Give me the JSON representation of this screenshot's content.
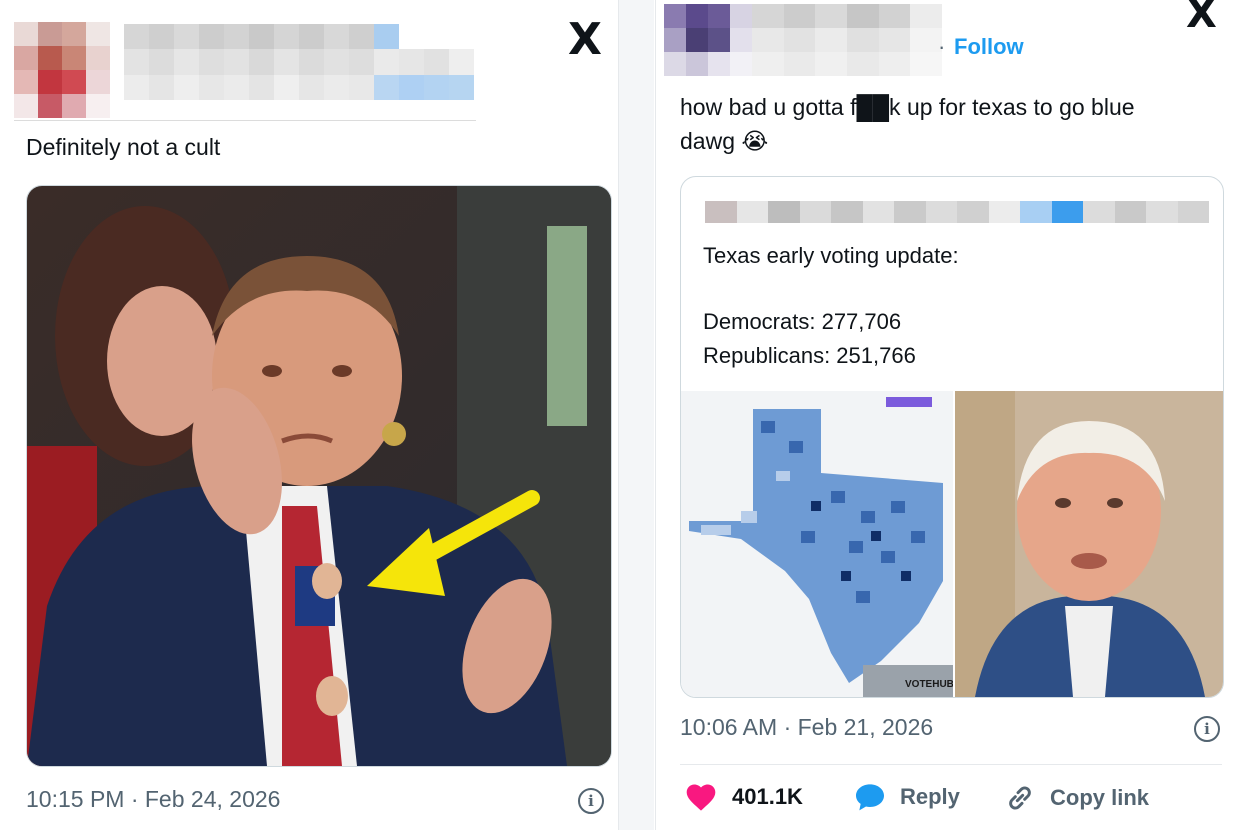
{
  "left_tweet": {
    "text": "Definitely not a cult",
    "timestamp": "10:15 PM · Feb 24, 2026",
    "logo": "X"
  },
  "right_tweet": {
    "follow_label": "Follow",
    "text_line1": "how bad u gotta f██k up for texas to go blue",
    "text_line2": "dawg 😭",
    "timestamp": "10:06 AM · Feb 21, 2026",
    "logo": "X",
    "quote": {
      "line1": "Texas early voting update:",
      "line2": "Democrats: 277,706",
      "line3": "Republicans: 251,766"
    },
    "actions": {
      "likes": "401.1K",
      "reply": "Reply",
      "copy_link": "Copy link"
    },
    "map_watermark": "VOTEHUB"
  },
  "colors": {
    "accent_blue": "#1d9bf0",
    "like_pink": "#f91880",
    "meta_gray": "#536471",
    "arrow_yellow": "#f5e50a",
    "map_blue": "#3d7dc4"
  },
  "icons": [
    "x-logo-icon",
    "heart-icon",
    "reply-bubble-icon",
    "link-icon",
    "info-icon",
    "arrow-icon",
    "crying-emoji-icon"
  ]
}
